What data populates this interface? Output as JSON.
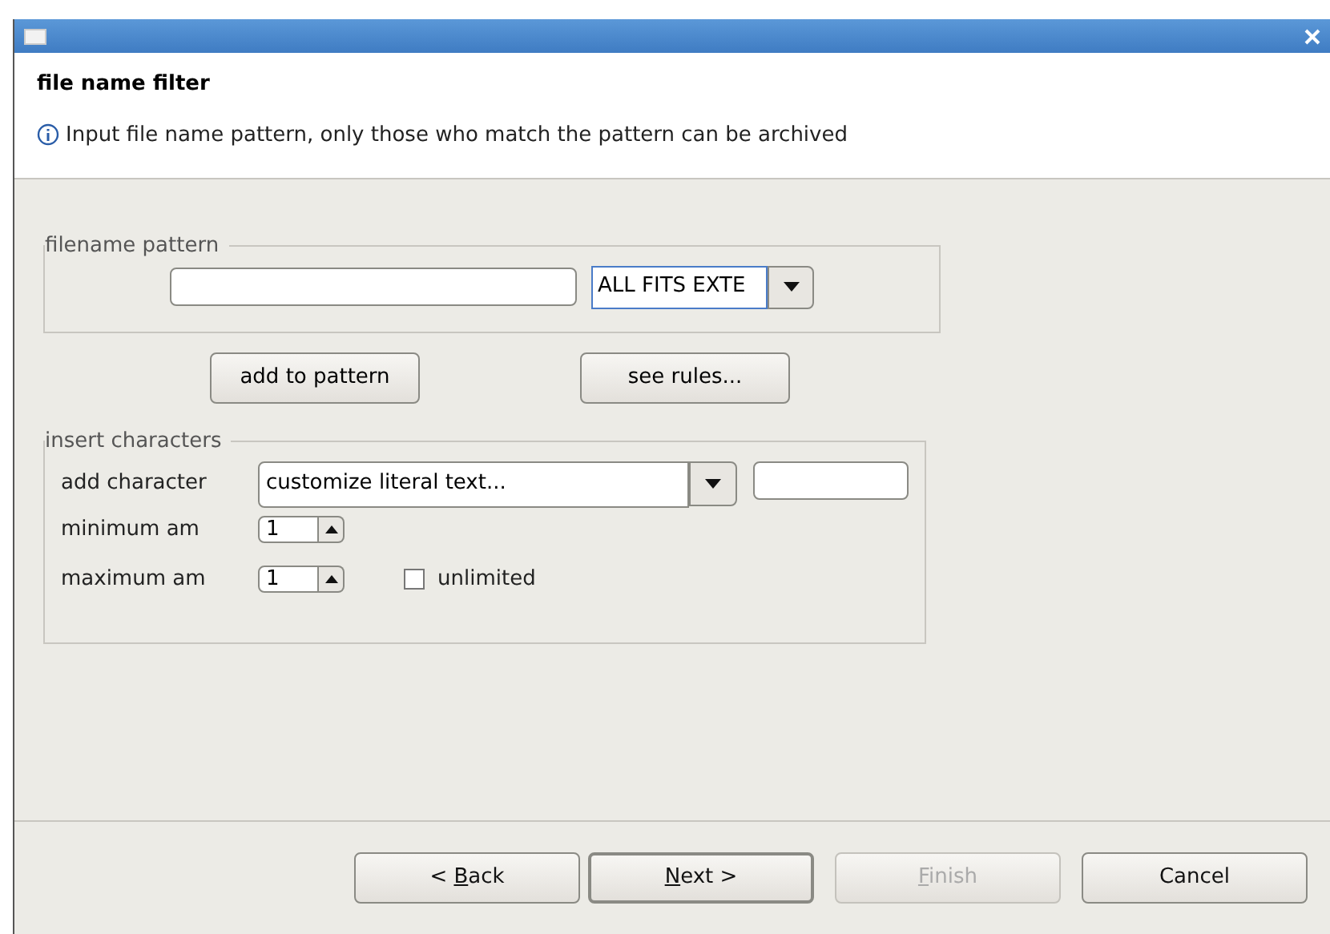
{
  "header": {
    "title": "file name filter",
    "message": "Input file name pattern, only those who match the pattern can be archived"
  },
  "pattern_group": {
    "legend": "filename pattern",
    "extension_combo": "ALL FITS EXTE"
  },
  "actions": [
    {
      "label": "add to pattern"
    },
    {
      "label": "see rules..."
    }
  ],
  "insert_group": {
    "legend": "insert characters",
    "add_character": {
      "label": "add character",
      "combo": "customize literal text..."
    },
    "minimum": {
      "label": "minimum am",
      "value": "1"
    },
    "maximum": {
      "label": "maximum am",
      "value": "1",
      "unlimited": {
        "label": "unlimited",
        "checked": false
      }
    }
  },
  "buttons": [
    {
      "before": "< ",
      "mnemonic": "B",
      "after": "ack",
      "disabled": false,
      "default": false
    },
    {
      "mnemonic": "N",
      "after": "ext >",
      "disabled": false,
      "default": true
    },
    {
      "mnemonic": "F",
      "after": "inish",
      "disabled": true,
      "default": false
    },
    {
      "after": "Cancel",
      "disabled": false,
      "default": false
    }
  ]
}
